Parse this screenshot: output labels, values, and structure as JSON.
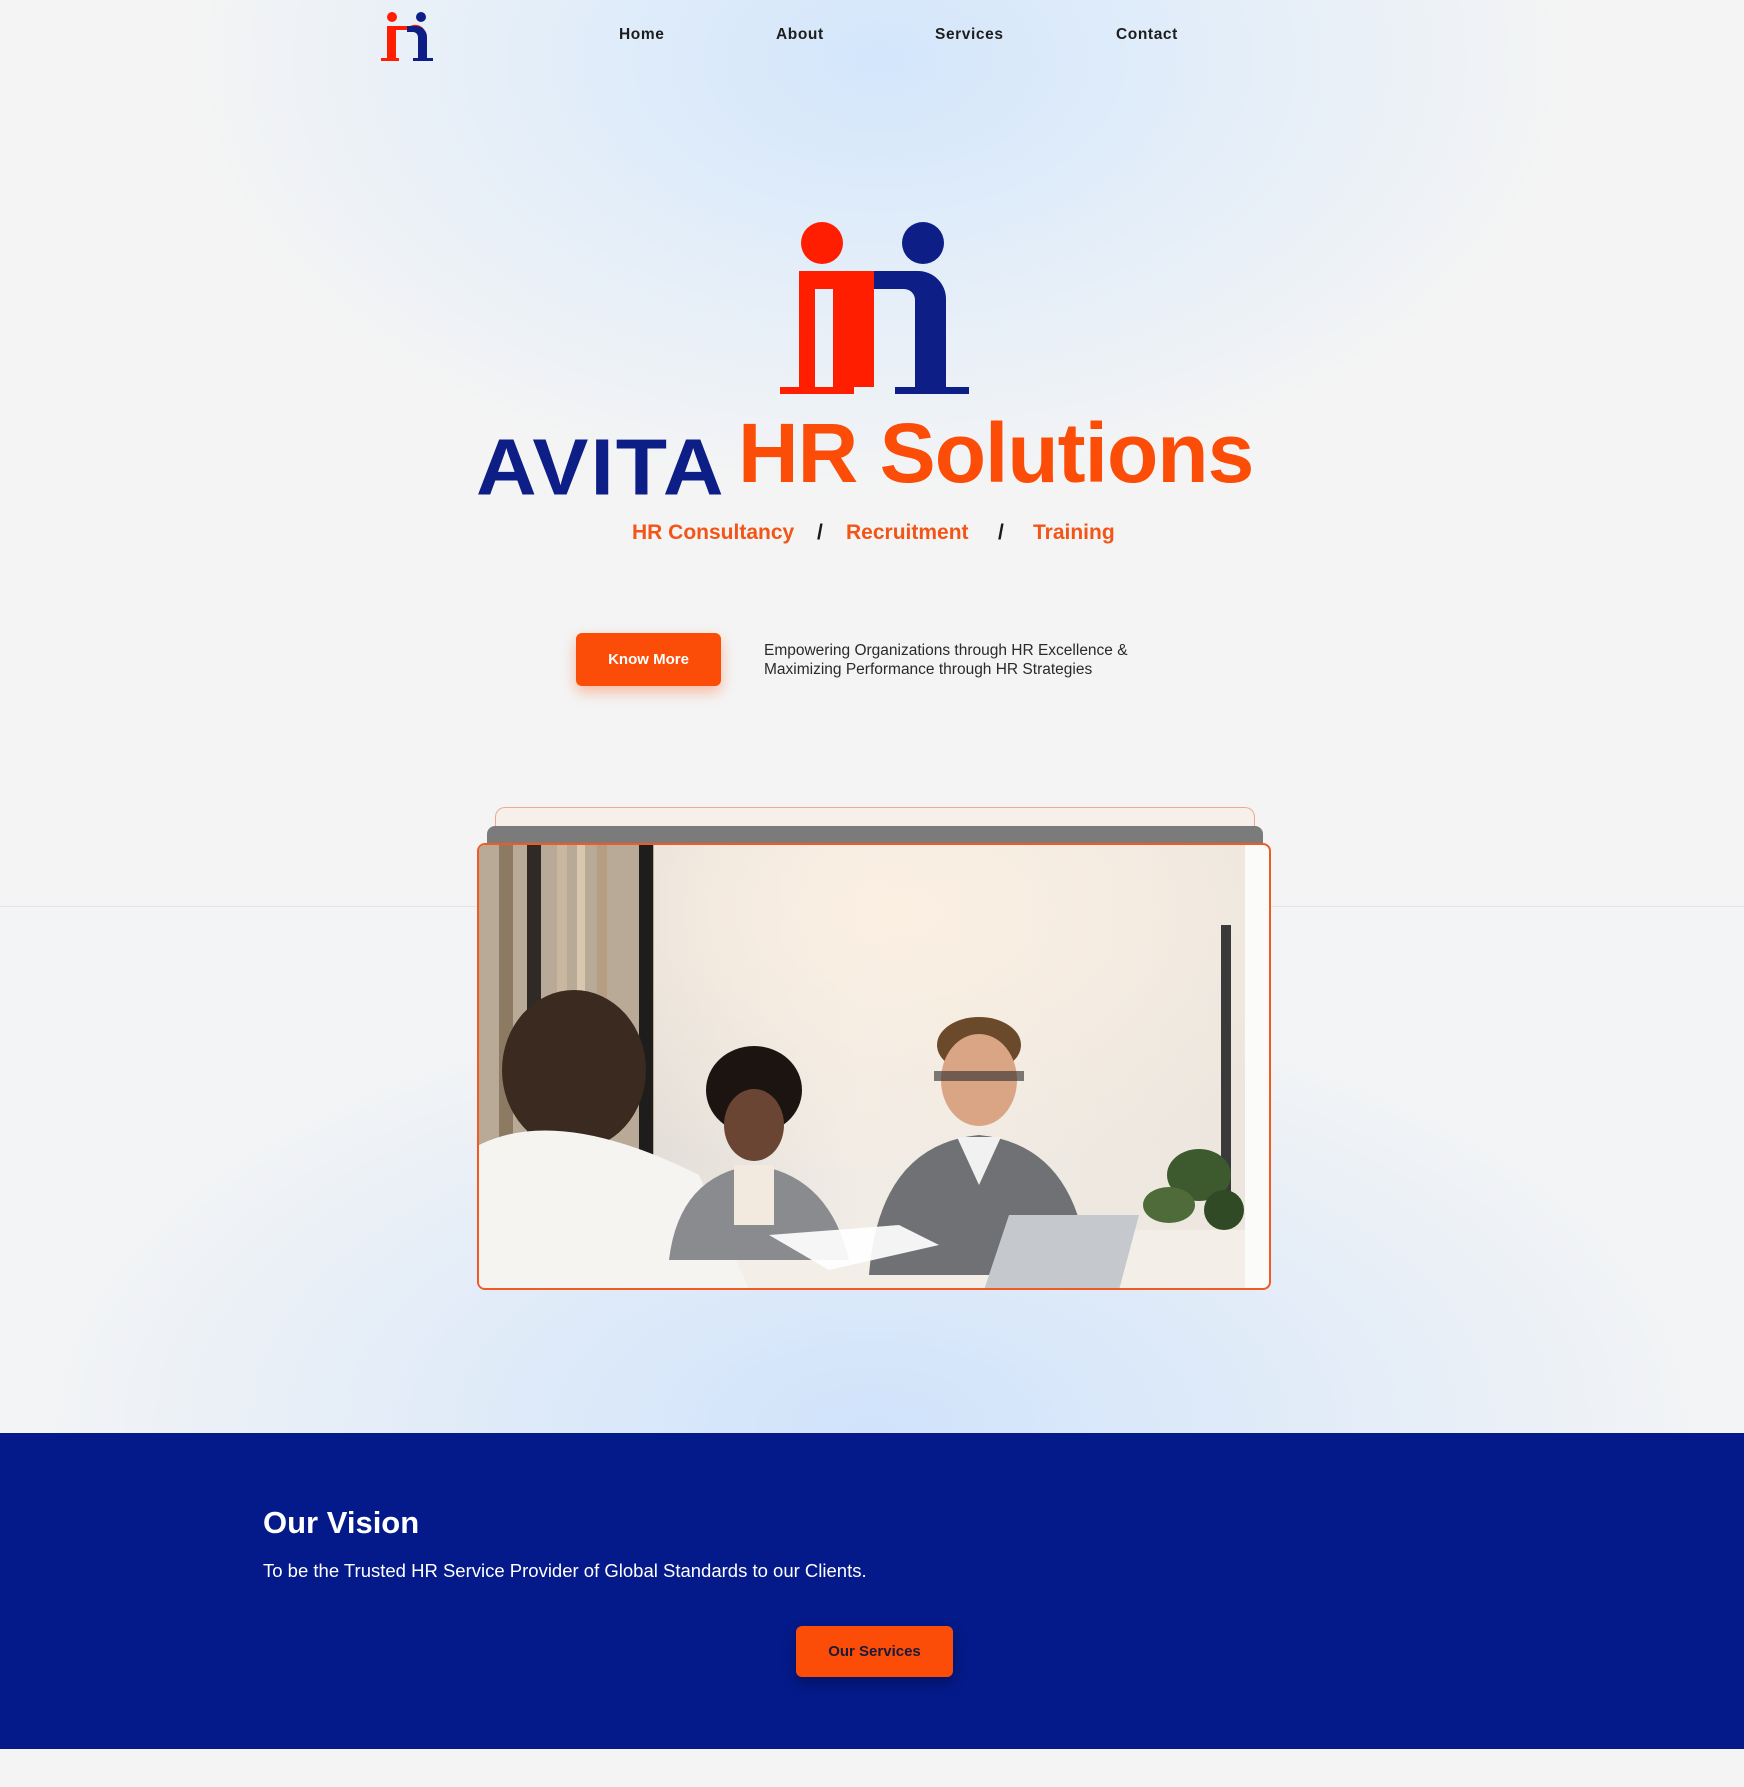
{
  "nav": {
    "logo": "AVITA HR Solutions logo",
    "links": [
      "Home",
      "About",
      "Services",
      "Contact"
    ]
  },
  "hero": {
    "brand_left": "AVITA",
    "brand_right": "HR Solutions",
    "tags": [
      "HR Consultancy",
      "Recruitment",
      "Training"
    ],
    "separator": "/",
    "cta_label": "Know More",
    "description_lines": [
      "Empowering Organizations through HR Excellence &",
      "Maximizing Performance through HR Strategies"
    ],
    "photo": "office-meeting-photo"
  },
  "vision": {
    "title": "Our Vision",
    "text": "To be the Trusted HR Service Provider of Global Standards to our Clients.",
    "button_label": "Our Services"
  },
  "colors": {
    "brand_orange": "#fb4d08",
    "brand_red": "#ff1e00",
    "brand_navy": "#0d1f86",
    "vision_bg": "#041a8a"
  }
}
